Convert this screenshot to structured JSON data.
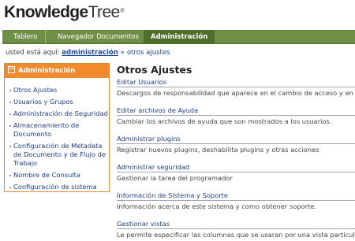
{
  "logo": {
    "knowledge": "Knowledge",
    "tree": "Tree",
    "reg": "®"
  },
  "nav": {
    "tabs": [
      {
        "label": "Tablero"
      },
      {
        "label": "Navegador Documentos"
      },
      {
        "label": "Administración",
        "active": true
      }
    ],
    "colors": {
      "bar": "#6f8f46",
      "active": "#4f6e2a"
    }
  },
  "breadcrumb": {
    "prefix": "usted está aquí:",
    "items": [
      "administración",
      "otros ajustes"
    ],
    "separator": "»"
  },
  "sidebar": {
    "title": "Administración",
    "items": [
      "Otros Ajustes",
      "Usuarios y Grupos",
      "Administración de Seguridad",
      "Almacenamiento de Documento",
      "Configuración de Metadata de Documento y de Flujo de Trabajo",
      "Nombre de Consulta",
      "Configuración de sistema"
    ],
    "accent": "#f08a2c"
  },
  "main": {
    "title": "Otros Ajustes",
    "items": [
      {
        "title": "Editar Usuarios",
        "desc": "Descargos de responsabilidad que aparece en el cambio de acceso y en la parte"
      },
      {
        "title": "Editar archivos de Ayuda",
        "desc": "Cambiar los archivos de ayuda que son mostrados a los usuarios."
      },
      {
        "title": "Administrar plugins",
        "desc": "Registrar nuevos plugins, deshabilita plugins y otras acciones"
      },
      {
        "title": "Administrar seguridad",
        "desc": "Gestionar la tarea del programador"
      },
      {
        "title": "Información de Sistema y Soporte",
        "desc": "Información acerca de este sistema y como obtener soporte."
      },
      {
        "title": "Gestionar vistas",
        "desc": "Le permite especificar las columnas que se usaran por una vista particular (ej. E"
      }
    ]
  }
}
